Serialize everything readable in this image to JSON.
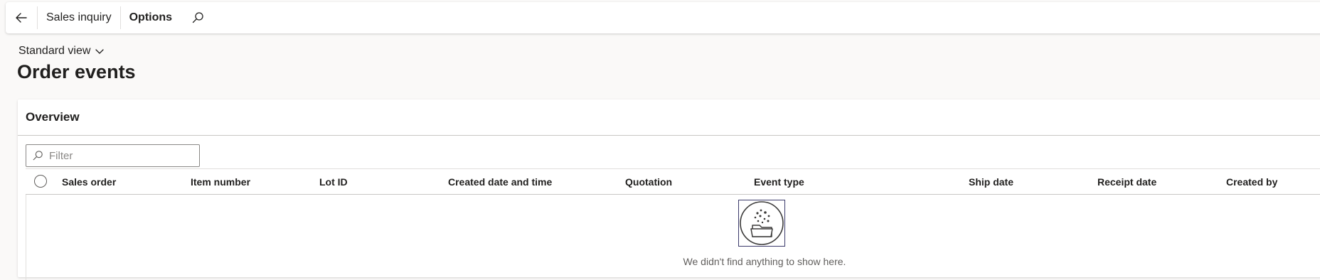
{
  "topbar": {
    "back_icon": "back-arrow-icon",
    "items": [
      {
        "label": "Sales inquiry"
      },
      {
        "label": "Options"
      }
    ],
    "search_icon": "search-icon"
  },
  "view": {
    "selector_label": "Standard view",
    "chevron_icon": "chevron-down-icon"
  },
  "page": {
    "title": "Order events"
  },
  "overview": {
    "header": "Overview",
    "filter_placeholder": "Filter",
    "columns": [
      "Sales order",
      "Item number",
      "Lot ID",
      "Created date and time",
      "Quotation",
      "Event type",
      "Ship date",
      "Receipt date",
      "Created by"
    ],
    "empty_message": "We didn't find anything to show here.",
    "empty_icon": "empty-folder-icon"
  }
}
